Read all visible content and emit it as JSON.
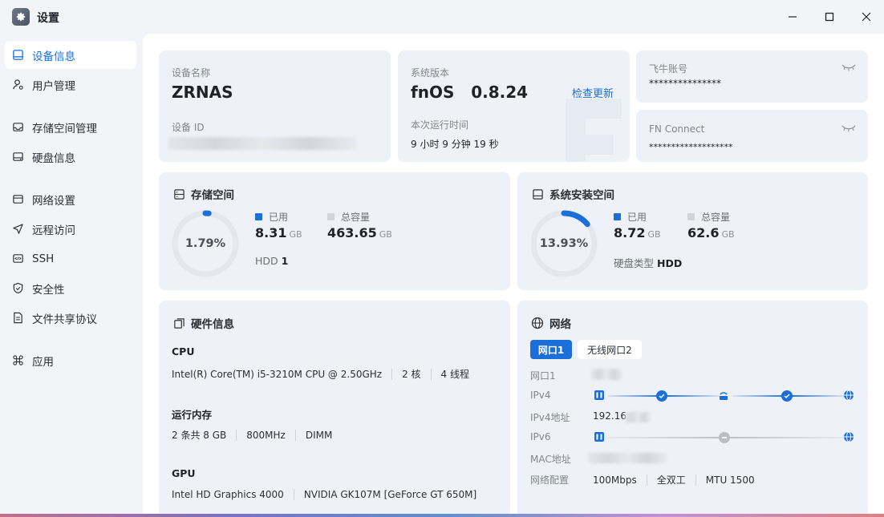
{
  "window": {
    "title": "设置",
    "app_icon": "gear-icon",
    "controls": {
      "minimize": "minimize-icon",
      "maximize": "maximize-icon",
      "close": "close-icon"
    }
  },
  "sidebar": {
    "items": [
      {
        "label": "设备信息",
        "icon": "monitor-icon",
        "active": true
      },
      {
        "label": "用户管理",
        "icon": "user-icon",
        "active": false
      },
      {
        "label": "存储空间管理",
        "icon": "storage-icon",
        "active": false
      },
      {
        "label": "硬盘信息",
        "icon": "disk-icon",
        "active": false
      },
      {
        "label": "网络设置",
        "icon": "network-icon",
        "active": false
      },
      {
        "label": "远程访问",
        "icon": "send-icon",
        "active": false
      },
      {
        "label": "SSH",
        "icon": "code-icon",
        "active": false
      },
      {
        "label": "安全性",
        "icon": "shield-icon",
        "active": false
      },
      {
        "label": "文件共享协议",
        "icon": "file-icon",
        "active": false
      },
      {
        "label": "应用",
        "icon": "command-icon",
        "active": false
      }
    ]
  },
  "device": {
    "name_label": "设备名称",
    "name_value": "ZRNAS",
    "id_label": "设备 ID"
  },
  "system": {
    "version_label": "系统版本",
    "version_value": "fnOS   0.8.24",
    "check_update": "检查更新",
    "uptime_label": "本次运行时间",
    "uptime_value": "9 小时 9 分钟 19 秒"
  },
  "account": {
    "feiniu_label": "飞牛账号",
    "feiniu_value": "***************",
    "fnconnect_label": "FN Connect",
    "fnconnect_value": "*******************",
    "eye_icon": "eye-closed-icon"
  },
  "storage": {
    "title": "存储空间",
    "percent_text": "1.79%",
    "percent": 1.79,
    "used_label": "已用",
    "used_value": "8.31",
    "used_unit": "GB",
    "total_label": "总容量",
    "total_value": "463.65",
    "total_unit": "GB",
    "disk_type": "HDD",
    "disk_count": "1"
  },
  "sysinstall": {
    "title": "系统安装空间",
    "percent_text": "13.93%",
    "percent": 13.93,
    "used_label": "已用",
    "used_value": "8.72",
    "used_unit": "GB",
    "total_label": "总容量",
    "total_value": "62.6",
    "total_unit": "GB",
    "disk_type_label": "硬盘类型",
    "disk_type_value": "HDD"
  },
  "hardware": {
    "title": "硬件信息",
    "cpu_head": "CPU",
    "cpu_model": "Intel(R) Core(TM) i5-3210M CPU @ 2.50GHz",
    "cpu_cores": "2 核",
    "cpu_threads": "4 线程",
    "mem_head": "运行内存",
    "mem_size": "2 条共 8 GB",
    "mem_freq": "800MHz",
    "mem_type": "DIMM",
    "gpu_head": "GPU",
    "gpu_1": "Intel HD Graphics 4000",
    "gpu_2": "NVIDIA GK107M [GeForce GT 650M]"
  },
  "network": {
    "title": "网络",
    "tabs": [
      "网口1",
      "无线网口2"
    ],
    "rows": {
      "port": "网口1",
      "ipv4": "IPv4",
      "ipv4_addr_label": "IPv4地址",
      "ipv4_addr_value": "192.16",
      "ipv6": "IPv6",
      "mac": "MAC地址",
      "config": "网络配置"
    },
    "config_values": [
      "100Mbps",
      "全双工",
      "MTU 1500"
    ],
    "colors": {
      "accent": "#1a6fdb",
      "inactive": "#b9bec7"
    }
  },
  "colors": {
    "accent": "#1a6fdb",
    "card_bg": "#eef1f7",
    "ring_track": "#e4e7ec"
  }
}
